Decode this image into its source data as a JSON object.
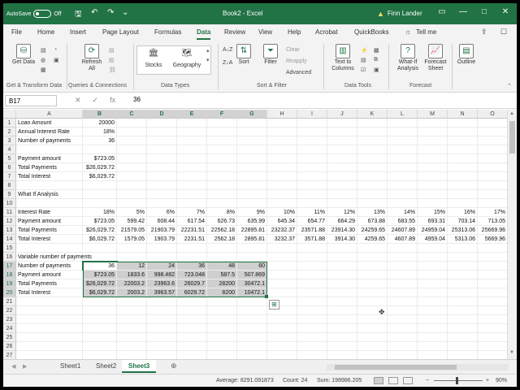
{
  "titlebar": {
    "autosave_label": "AutoSave",
    "autosave_state": "Off",
    "doc_title": "Book2 - Excel",
    "user_name": "Finn Lander",
    "save_glyph": "🖫",
    "undo_glyph": "↶",
    "redo_glyph": "↷",
    "customize_glyph": "⌄",
    "ribbon_opts_glyph": "▭",
    "minimize_glyph": "—",
    "restore_glyph": "□",
    "close_glyph": "✕"
  },
  "tabs": [
    "File",
    "Home",
    "Insert",
    "Page Layout",
    "Formulas",
    "Data",
    "Review",
    "View",
    "Help",
    "Acrobat",
    "QuickBooks"
  ],
  "active_tab": "Data",
  "tell_me": "Tell me",
  "ribbon": {
    "get_data": "Get Data",
    "refresh_all": "Refresh All",
    "stocks": "Stocks",
    "geography": "Geography",
    "sort": "Sort",
    "filter": "Filter",
    "clear": "Clear",
    "reapply": "Reapply",
    "advanced": "Advanced",
    "text_to_columns": "Text to Columns",
    "what_if": "What-If Analysis",
    "forecast_sheet": "Forecast Sheet",
    "outline": "Outline",
    "groups": {
      "get_transform": "Get & Transform Data",
      "queries": "Queries & Connections",
      "data_types": "Data Types",
      "sort_filter": "Sort & Filter",
      "data_tools": "Data Tools",
      "forecast": "Forecast"
    }
  },
  "formula_bar": {
    "name_box": "B17",
    "cancel_glyph": "✕",
    "enter_glyph": "✓",
    "fx_glyph": "fx",
    "formula": "36"
  },
  "columns": [
    "A",
    "B",
    "C",
    "D",
    "E",
    "F",
    "G",
    "H",
    "I",
    "J",
    "K",
    "L",
    "M",
    "N",
    "O"
  ],
  "rows": [
    "1",
    "2",
    "3",
    "4",
    "5",
    "6",
    "7",
    "8",
    "9",
    "10",
    "11",
    "12",
    "13",
    "14",
    "15",
    "16",
    "17",
    "18",
    "19",
    "20",
    "21",
    "22",
    "23",
    "24",
    "25",
    "26",
    "27"
  ],
  "cells": {
    "A1": "Loan Amount",
    "B1": "20000",
    "A2": "Annual Interest Rate",
    "B2": "18%",
    "A3": "Number of payments",
    "B3": "36",
    "A5": "Payment amount",
    "B5": "$723.05",
    "A6": "Total Payments",
    "B6": "$26,029.72",
    "A7": "Total Interest",
    "B7": "$6,029.72",
    "A9": "What If Analysis",
    "A11": "Interest Rate",
    "B11": "18%",
    "C11": "5%",
    "D11": "6%",
    "E11": "7%",
    "F11": "8%",
    "G11": "9%",
    "H11": "10%",
    "I11": "11%",
    "J11": "12%",
    "K11": "13%",
    "L11": "14%",
    "M11": "15%",
    "N11": "16%",
    "O11": "17%",
    "A12": "Payment amount",
    "B12": "$723.05",
    "C12": "599.42",
    "D12": "608.44",
    "E12": "617.54",
    "F12": "626.73",
    "G12": "635.99",
    "H12": "645.34",
    "I12": "654.77",
    "J12": "664.29",
    "K12": "673.88",
    "L12": "683.55",
    "M12": "693.31",
    "N12": "703.14",
    "O12": "713.05",
    "A13": "Total Payments",
    "B13": "$26,029.72",
    "C13": "21579.05",
    "D13": "21903.79",
    "E13": "22231.51",
    "F13": "22562.18",
    "G13": "22895.81",
    "H13": "23232.37",
    "I13": "23571.88",
    "J13": "23914.30",
    "K13": "24259.65",
    "L13": "24607.89",
    "M13": "24959.04",
    "N13": "25313.06",
    "O13": "25669.96",
    "A14": "Total Interest",
    "B14": "$6,029.72",
    "C14": "1579.05",
    "D14": "1903.79",
    "E14": "2231.51",
    "F14": "2562.18",
    "G14": "2895.81",
    "H14": "3232.37",
    "I14": "3571.88",
    "J14": "3914.30",
    "K14": "4259.65",
    "L14": "4607.89",
    "M14": "4959.04",
    "N14": "5313.06",
    "O14": "5669.96",
    "A16": "Variable number of payments",
    "A17": "Number of payments",
    "B17": "36",
    "C17": "12",
    "D17": "24",
    "E17": "36",
    "F17": "48",
    "G17": "60",
    "A18": "Payment amount",
    "B18": "$723.05",
    "C18": "1833.6",
    "D18": "998.482",
    "E18": "723.048",
    "F18": "587.5",
    "G18": "507.869",
    "A19": "Total Payments",
    "B19": "$26,029.72",
    "C19": "22003.2",
    "D19": "23963.6",
    "E19": "26029.7",
    "F19": "28200",
    "G19": "30472.1",
    "A20": "Total Interest",
    "B20": "$6,029.72",
    "C20": "2003.2",
    "D20": "3963.57",
    "E20": "6029.72",
    "F20": "8200",
    "G20": "10472.1"
  },
  "sheets": [
    "Sheet1",
    "Sheet2",
    "Sheet3"
  ],
  "active_sheet": "Sheet3",
  "status": {
    "average": "Average: 8291.091873",
    "count": "Count: 24",
    "sum": "Sum: 198986.205",
    "zoom": "90%",
    "zoom_minus": "−",
    "zoom_plus": "+"
  },
  "accent_color": "#217346",
  "selection_shade": "#cfcfcf"
}
